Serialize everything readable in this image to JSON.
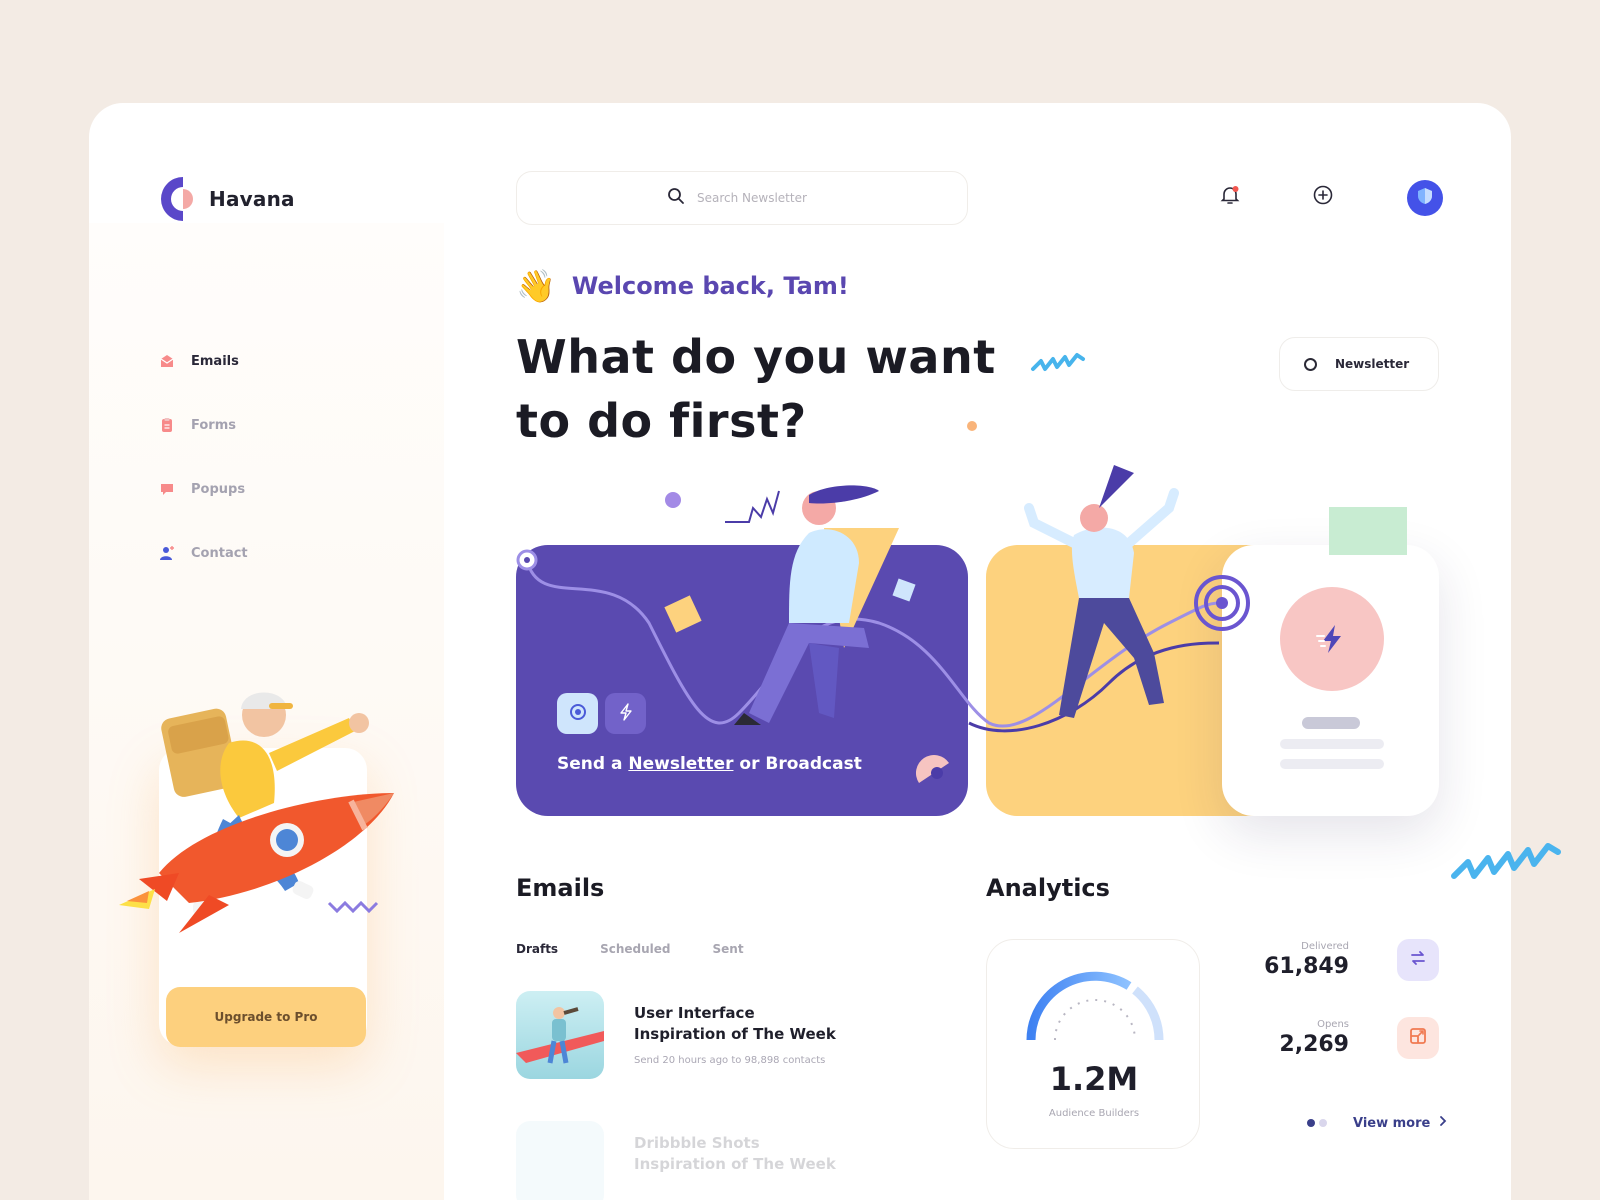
{
  "app": {
    "name": "Havana"
  },
  "search": {
    "placeholder": "Search Newsletter"
  },
  "sidebar": {
    "items": [
      {
        "label": "Emails",
        "icon": "mail-icon",
        "active": true
      },
      {
        "label": "Forms",
        "icon": "clipboard-icon",
        "active": false
      },
      {
        "label": "Popups",
        "icon": "chat-icon",
        "active": false
      },
      {
        "label": "Contact",
        "icon": "user-add-icon",
        "active": false
      }
    ],
    "upgrade_label": "Upgrade to Pro"
  },
  "header": {
    "icons": [
      "bell-icon",
      "plus-circle-icon"
    ],
    "notification_dot": true
  },
  "welcome": {
    "emoji": "👋",
    "text": "Welcome back, Tam!"
  },
  "headline": "What do you want to do first?",
  "newsletter_pill": {
    "label": "Newsletter"
  },
  "hero": {
    "prefix": "Send a ",
    "link": "Newsletter",
    "suffix": " or Broadcast"
  },
  "emails": {
    "title": "Emails",
    "tabs": [
      "Drafts",
      "Scheduled",
      "Sent"
    ],
    "active_tab": "Drafts",
    "items": [
      {
        "title": "User Interface Inspiration of The Week",
        "meta": "Send 20 hours ago to 98,898 contacts"
      },
      {
        "title": "Dribbble Shots Inspiration of The Week",
        "meta": ""
      }
    ]
  },
  "analytics": {
    "title": "Analytics",
    "gauge": {
      "value": "1.2M",
      "label": "Audience Builders"
    },
    "stats": [
      {
        "label": "Delivered",
        "value": "61,849"
      },
      {
        "label": "Opens",
        "value": "2,269"
      }
    ],
    "view_more": "View more"
  },
  "colors": {
    "primary": "#5a4ab0",
    "accent_yellow": "#fdd27e",
    "text_dark": "#1b1b24",
    "muted": "#a8a6b1"
  }
}
